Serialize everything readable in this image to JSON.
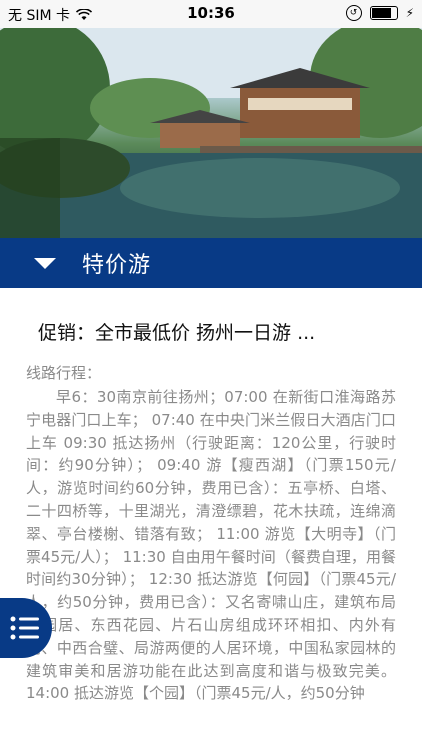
{
  "status_bar": {
    "carrier": "无 SIM 卡",
    "time": "10:36",
    "battery_level": 0.85,
    "icons": [
      "wifi-icon",
      "rotation-lock-icon",
      "battery-icon",
      "charging-icon"
    ]
  },
  "hero": {
    "image": "garden-pavilion-photo"
  },
  "section": {
    "title": "特价游",
    "toggle_icon": "caret-down-icon"
  },
  "promo": {
    "title": "促销：全市最低价 扬州一日游 ..."
  },
  "route": {
    "label": "线路行程：",
    "body": "早6：30南京前往扬州；07:00 在新街口淮海路苏宁电器门口上车； 07:40 在中央门米兰假日大酒店门口上车 09:30 抵达扬州（行驶距离：120公里，行驶时间：约90分钟）； 09:40 游【瘦西湖】（门票150元/人，游览时间约60分钟，费用已含）：五亭桥、白塔、二十四桥等，十里湖光，清澄缥碧，花木扶疏，连绵滴翠、亭台楼榭、错落有致； 11:00 游览【大明寺】（门票45元/人）； 11:30 自由用午餐时间（餐费自理，用餐时间约30分钟）； 12:30 抵达游览【何园】（门票45元/人，约50分钟，费用已含）：又名寄啸山庄，建筑布局由园居、东西花园、片石山房组成环环相扣、内外有别、中西合璧、局游两便的人居环境，中国私家园林的建筑审美和居游功能在此达到高度和谐与极致完美。 14:00 抵达游览【个园】（门票45元/人，约50分钟"
  },
  "menu_button": {
    "icon": "list-menu-icon"
  },
  "colors": {
    "header_blue": "#083a86",
    "text_gray": "#8a8a8a"
  }
}
